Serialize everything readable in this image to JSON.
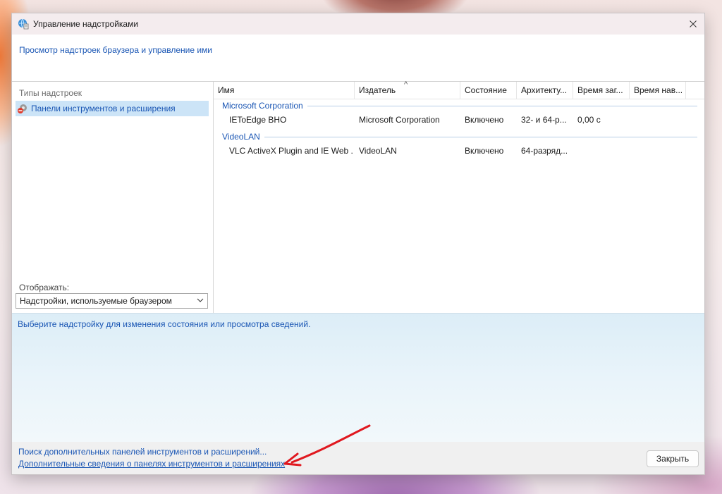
{
  "window": {
    "title": "Управление надстройками",
    "header_link": "Просмотр надстроек браузера и управление ими"
  },
  "left_pane": {
    "types_label": "Типы надстроек",
    "types_item": "Панели инструментов и расширения",
    "show_label": "Отображать:",
    "show_select_value": "Надстройки, используемые браузером"
  },
  "table": {
    "columns": [
      "Имя",
      "Издатель",
      "Состояние",
      "Архитекту...",
      "Время заг...",
      "Время нав..."
    ],
    "groups": [
      {
        "name": "Microsoft Corporation",
        "rows": [
          [
            "IEToEdge BHO",
            "Microsoft Corporation",
            "Включено",
            "32- и 64-р...",
            "0,00 с",
            ""
          ]
        ]
      },
      {
        "name": "VideoLAN",
        "rows": [
          [
            "VLC ActiveX Plugin and IE Web ...",
            "VideoLAN",
            "Включено",
            "64-разряд...",
            "",
            ""
          ]
        ]
      }
    ]
  },
  "details": {
    "prompt": "Выберите надстройку для изменения состояния или просмотра сведений."
  },
  "footer": {
    "link_find": "Поиск дополнительных панелей инструментов и расширений...",
    "link_more_info": "Дополнительные сведения о панелях инструментов и расширениях",
    "close_label": "Закрыть"
  },
  "colors": {
    "link": "#1a56b4",
    "selection": "#cce4f7",
    "annotation_arrow": "#e0181f"
  }
}
